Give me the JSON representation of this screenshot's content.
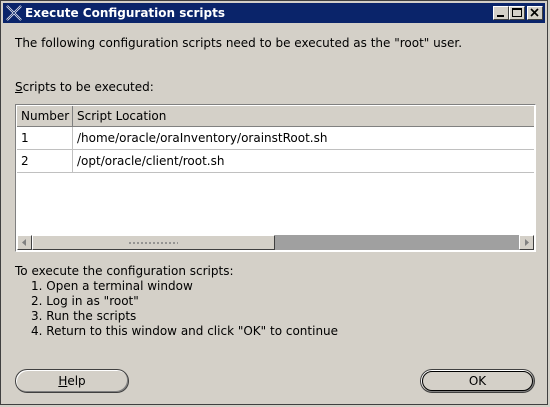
{
  "window": {
    "title": "Execute Configuration scripts"
  },
  "description": "The following configuration scripts need to be executed as the \"root\" user.",
  "scripts_label": {
    "mnemonic": "S",
    "rest": "cripts to be executed:"
  },
  "table": {
    "columns": [
      "Number",
      "Script Location"
    ],
    "rows": [
      {
        "number": "1",
        "location": "/home/oracle/oraInventory/orainstRoot.sh"
      },
      {
        "number": "2",
        "location": "/opt/oracle/client/root.sh"
      }
    ]
  },
  "instructions": {
    "heading": "To execute the configuration scripts:",
    "steps": [
      "1. Open a terminal window",
      "2. Log in as \"root\"",
      "3. Run the scripts",
      "4. Return to this window and click \"OK\" to continue"
    ]
  },
  "buttons": {
    "help": {
      "mnemonic": "H",
      "rest": "elp"
    },
    "ok": "OK"
  }
}
